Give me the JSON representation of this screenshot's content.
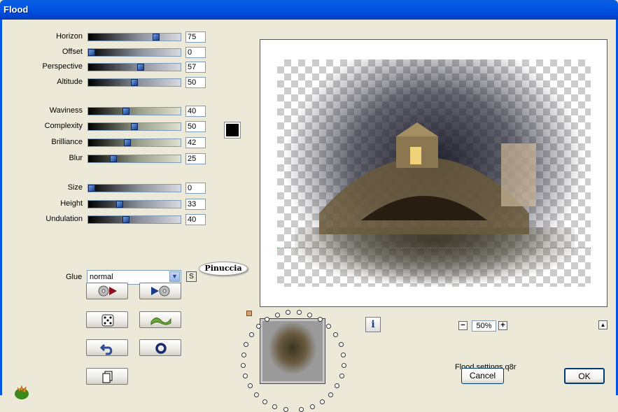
{
  "window": {
    "title": "Flood"
  },
  "sliders": [
    {
      "label": "Horizon",
      "value": "75",
      "pos": 0.75
    },
    {
      "label": "Offset",
      "value": "0",
      "pos": 0.0
    },
    {
      "label": "Perspective",
      "value": "57",
      "pos": 0.57
    },
    {
      "label": "Altitude",
      "value": "50",
      "pos": 0.5
    },
    {
      "label": "Waviness",
      "value": "40",
      "pos": 0.4
    },
    {
      "label": "Complexity",
      "value": "50",
      "pos": 0.5
    },
    {
      "label": "Brilliance",
      "value": "42",
      "pos": 0.42
    },
    {
      "label": "Blur",
      "value": "25",
      "pos": 0.25
    },
    {
      "label": "Size",
      "value": "0",
      "pos": 0.0
    },
    {
      "label": "Height",
      "value": "33",
      "pos": 0.33
    },
    {
      "label": "Undulation",
      "value": "40",
      "pos": 0.4
    }
  ],
  "color": {
    "swatch": "#000000"
  },
  "glue": {
    "label": "Glue",
    "value": "normal",
    "s_button": "S"
  },
  "badge": {
    "text": "Pinuccia"
  },
  "zoom": {
    "value": "50%",
    "minus": "−",
    "plus": "+"
  },
  "info_icon": "i",
  "up_icon": "▲",
  "settings_file": "Flood settings.q8r",
  "buttons": {
    "cancel": "Cancel",
    "ok": "OK"
  }
}
